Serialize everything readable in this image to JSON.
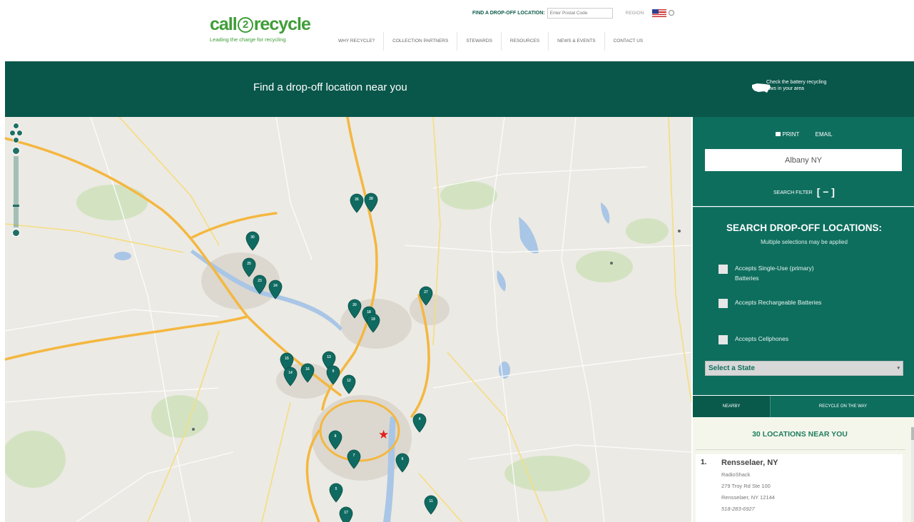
{
  "header": {
    "logo": {
      "part1": "call",
      "part2": "2",
      "part3": "recycle",
      "tagline": "Leading the charge for recycling"
    },
    "find_label": "FIND A DROP-OFF LOCATION:",
    "zip_placeholder": "Enter Postal Code",
    "region_label": "REGION",
    "nav": [
      "WHY RECYCLE?",
      "COLLECTION PARTNERS",
      "STEWARDS",
      "RESOURCES",
      "NEWS & EVENTS",
      "CONTACT US"
    ]
  },
  "banner": {
    "heading": "Find a drop-off location near you",
    "laws_link": "Check the battery recycling laws in your area"
  },
  "sidebar": {
    "print_label": "PRINT",
    "email_label": "EMAIL",
    "location_value": "Albany NY",
    "filter_label": "SEARCH FILTER",
    "filter_toggle": "[ − ]",
    "search_title": "SEARCH DROP-OFF LOCATIONS:",
    "search_sub": "Multiple selections may be applied",
    "options": [
      "Accepts Single-Use (primary) Batteries",
      "Accepts Rechargeable Batteries",
      "Accepts Cellphones"
    ],
    "state_select": "Select a State",
    "tabs": [
      "NEARBY",
      "RECYCLE ON THE WAY"
    ],
    "results_count": "30 LOCATIONS NEAR YOU",
    "results": [
      {
        "index": "1.",
        "city": "Rensselaer, NY",
        "store": "RadioShack",
        "address": "279 Troy Rd Ste 100",
        "citystate": "Rensselaer, NY 12144",
        "phone": "518-283-6927"
      }
    ]
  },
  "map": {
    "markers": [
      "26",
      "28",
      "30",
      "25",
      "23",
      "24",
      "27",
      "20",
      "18",
      "19",
      "15",
      "14",
      "16",
      "13",
      "9",
      "12",
      "8",
      "7",
      "4",
      "6",
      "5",
      "11",
      "17"
    ]
  },
  "colors": {
    "brand_green": "#3e9d36",
    "dark_teal": "#09564a",
    "panel_teal": "#0e6e5e",
    "marker": "#0f6b61",
    "home_star": "#e02020"
  },
  "icons": [
    "printer-icon",
    "us-map-icon",
    "map-marker-icon",
    "star-icon",
    "zoom-in-icon",
    "zoom-out-icon",
    "pan-icon",
    "dropdown-arrow-icon"
  ]
}
